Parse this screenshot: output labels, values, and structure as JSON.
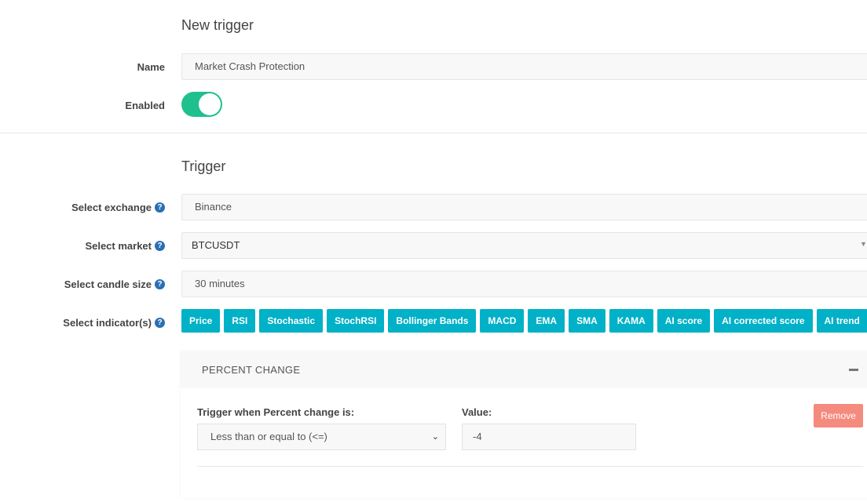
{
  "general": {
    "title": "New trigger",
    "name_label": "Name",
    "name_value": "Market Crash Protection",
    "enabled_label": "Enabled",
    "enabled": true
  },
  "trigger": {
    "title": "Trigger",
    "exchange_label": "Select exchange",
    "exchange_value": "Binance",
    "market_label": "Select market",
    "market_value": "BTCUSDT",
    "candle_label": "Select candle size",
    "candle_value": "30 minutes",
    "indicator_label": "Select indicator(s)",
    "indicators": [
      "Price",
      "RSI",
      "Stochastic",
      "StochRSI",
      "Bollinger Bands",
      "MACD",
      "EMA",
      "SMA",
      "KAMA",
      "AI score",
      "AI corrected score",
      "AI trend"
    ]
  },
  "panel": {
    "title": "PERCENT CHANGE",
    "condition_label": "Trigger when Percent change is:",
    "condition_value": "Less than or equal to (<=)",
    "value_label": "Value:",
    "value": "-4",
    "remove_label": "Remove"
  },
  "colors": {
    "accent": "#00b1c7",
    "toggle": "#1fc08e",
    "remove": "#f58a7f"
  }
}
